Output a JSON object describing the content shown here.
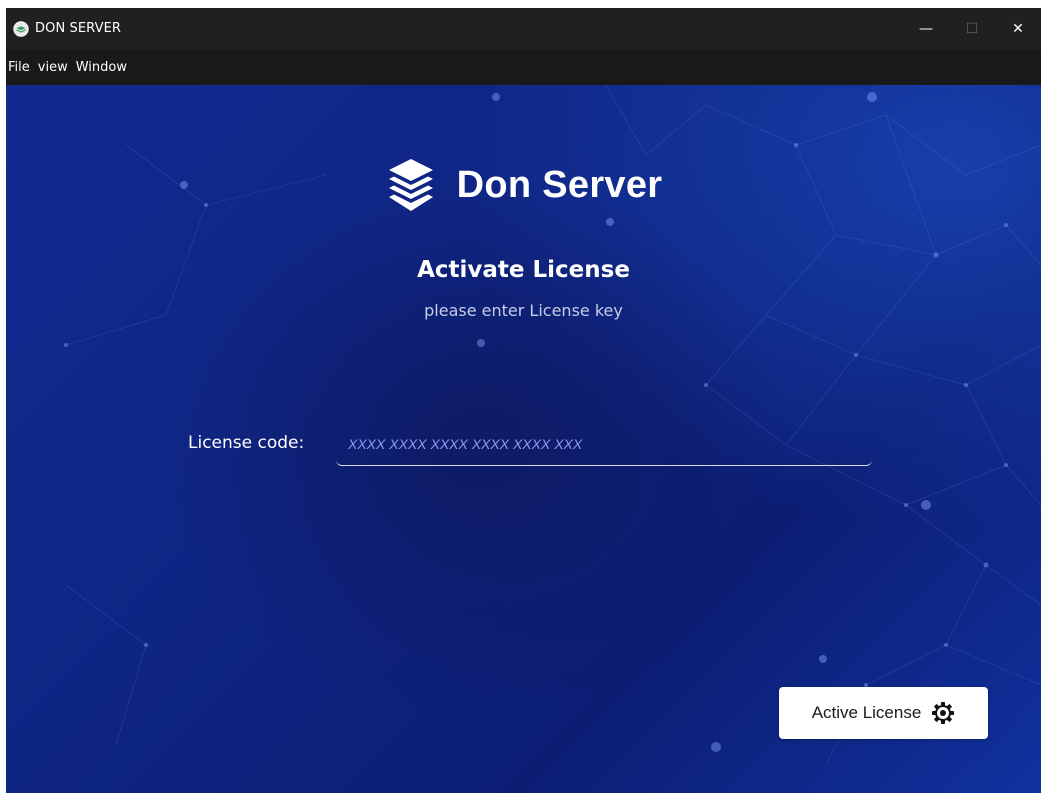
{
  "window": {
    "title": "DON SERVER",
    "controls": {
      "minimize": "—",
      "maximize": "☐",
      "close": "✕"
    }
  },
  "menubar": {
    "items": [
      {
        "label": "File"
      },
      {
        "label": "view"
      },
      {
        "label": "Window"
      }
    ]
  },
  "brand": {
    "name": "Don Server",
    "icon": "layers-icon"
  },
  "activation": {
    "title": "Activate License",
    "subtitle": "please enter License key",
    "field_label": "License code:",
    "field_value": "",
    "field_placeholder": "XXXX XXXX XXXX XXXX XXXX XXX",
    "button_label": "Active License",
    "button_icon": "gear-icon"
  },
  "colors": {
    "background_primary": "#0f2584",
    "background_accent": "#1842b0",
    "placeholder": "#8f9cf0",
    "button_bg": "#ffffff"
  }
}
